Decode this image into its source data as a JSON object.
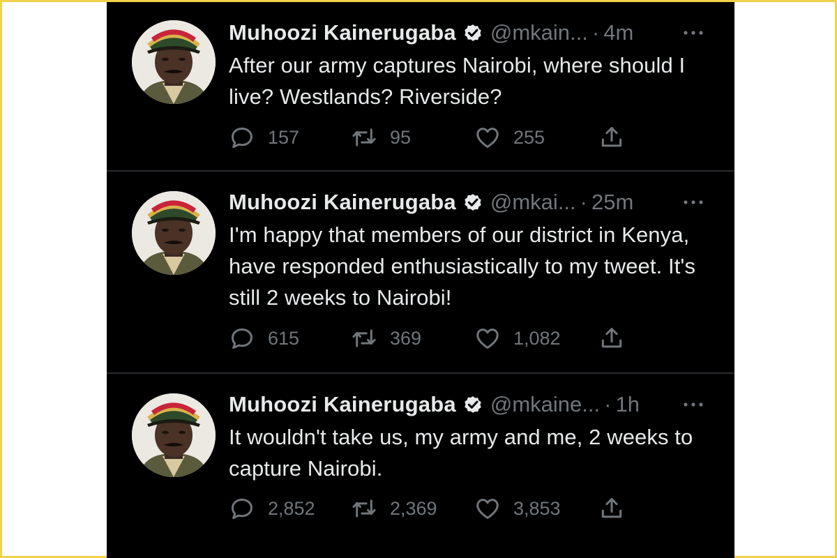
{
  "colors": {
    "background": "#000000",
    "text_primary": "#e7e9ea",
    "text_secondary": "#71767b",
    "frame_border": "#f2d14a",
    "divider": "#2a2d31"
  },
  "icons": [
    "verified-badge-icon",
    "more-options-icon",
    "reply-icon",
    "retweet-icon",
    "like-icon",
    "share-icon"
  ],
  "tweets": [
    {
      "name": "Muhoozi Kainerugaba",
      "handle": "@mkain...",
      "dot": "·",
      "time": "4m",
      "text": "After our army captures Nairobi, where should I live? Westlands? Riverside?",
      "replies": "157",
      "retweets": "95",
      "likes": "255"
    },
    {
      "name": "Muhoozi Kainerugaba",
      "handle": "@mkai...",
      "dot": "·",
      "time": "25m",
      "text": "I'm happy that members of our district in Kenya, have responded enthusiastically to my tweet. It's still 2 weeks to Nairobi!",
      "replies": "615",
      "retweets": "369",
      "likes": "1,082"
    },
    {
      "name": "Muhoozi Kainerugaba",
      "handle": "@mkaine...",
      "dot": "·",
      "time": "1h",
      "text": "It wouldn't take us, my army and me, 2 weeks to capture Nairobi.",
      "replies": "2,852",
      "retweets": "2,369",
      "likes": "3,853"
    }
  ]
}
